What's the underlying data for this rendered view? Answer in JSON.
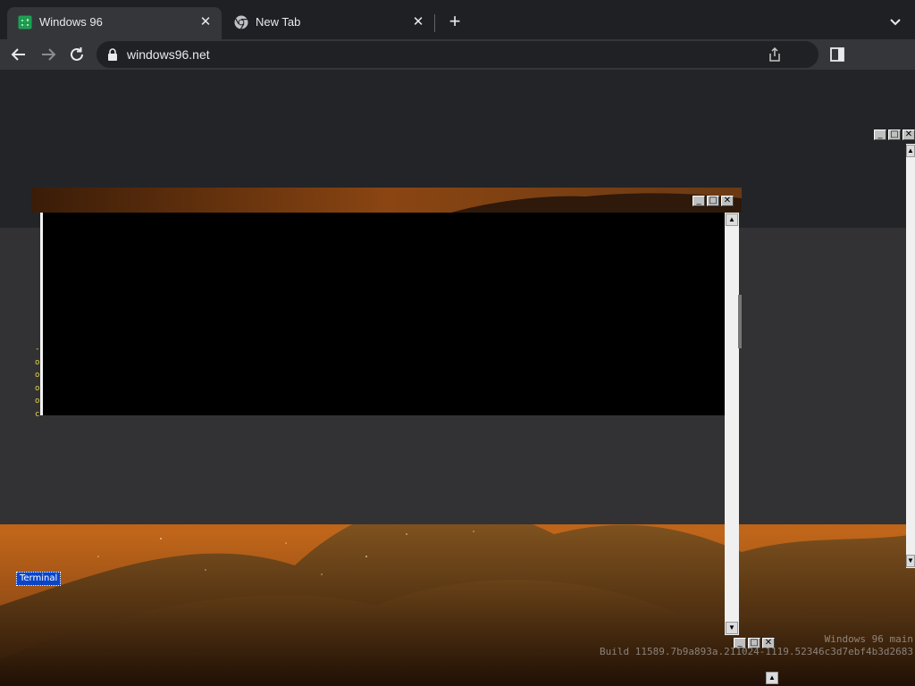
{
  "browser": {
    "tabs": [
      {
        "title": "Windows 96",
        "active": true,
        "icon": "windows96-favicon"
      },
      {
        "title": "New Tab",
        "active": false,
        "icon": "chrome-icon"
      }
    ],
    "address_bar": {
      "url": "windows96.net",
      "icon": "lock-icon"
    },
    "colors": {
      "tabstrip": "#1f2023",
      "toolbar": "#35363a",
      "omnibox": "#202124",
      "text": "#e8eaed"
    }
  },
  "desktop": {
    "icons": [
      {
        "label": "Terminal"
      }
    ],
    "watermark": {
      "line1": "Windows 96 main",
      "line2": "Build 11589.7b9a893a.211024-1119.52346c3d7ebf4b3d2683"
    }
  },
  "terminal": {
    "glyphs": [
      "-",
      "o",
      "o",
      "o",
      "o",
      "c"
    ]
  }
}
